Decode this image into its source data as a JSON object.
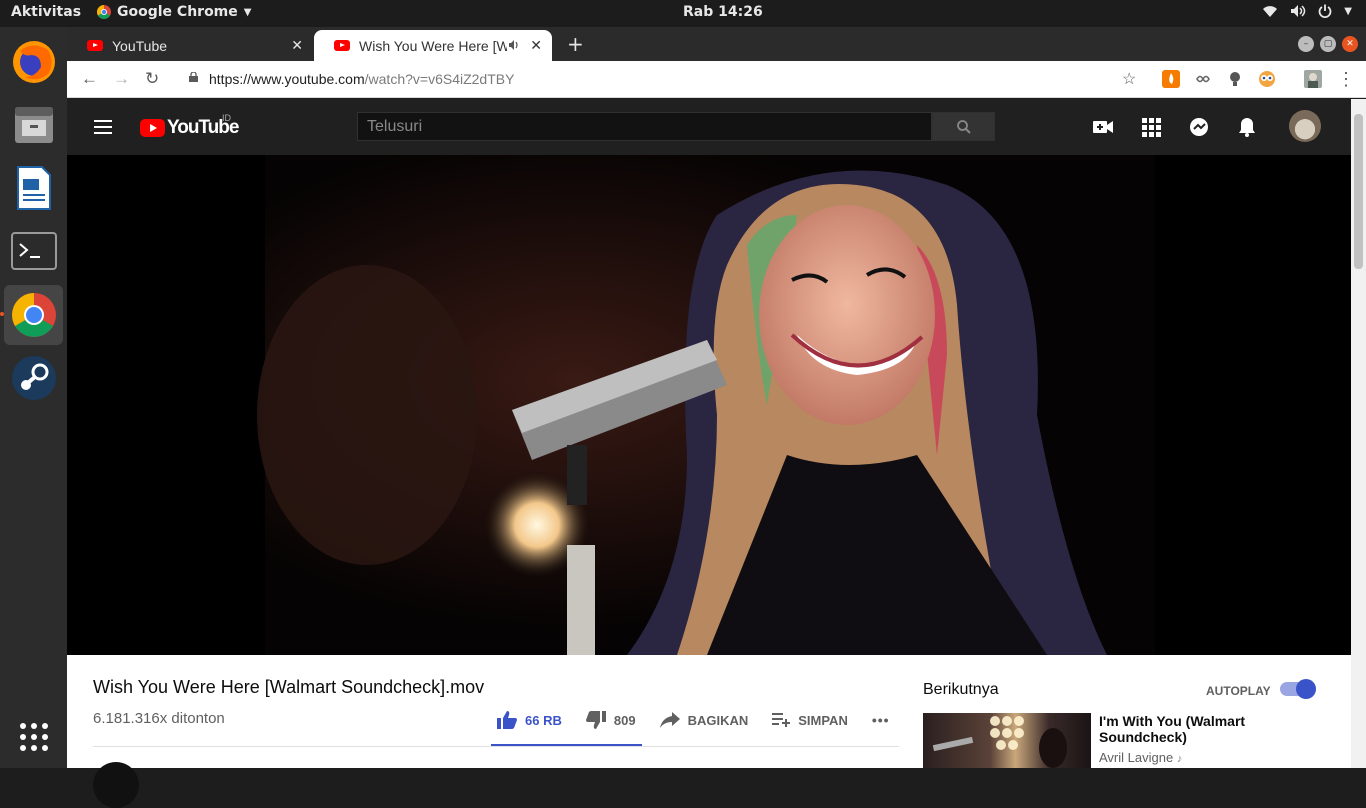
{
  "system": {
    "activities": "Aktivitas",
    "app_name": "Google Chrome",
    "clock": "Rab 14:26"
  },
  "dock": {
    "items": [
      "firefox-icon",
      "files-icon",
      "writer-icon",
      "terminal-icon",
      "chrome-icon",
      "steam-icon",
      "app-grid-icon"
    ]
  },
  "browser": {
    "tabs": [
      {
        "label": "YouTube"
      },
      {
        "label": "Wish You Were Here [W"
      }
    ],
    "url_host": "https://www.youtube.com",
    "url_path": "/watch?v=v6S4iZ2dTBY"
  },
  "youtube": {
    "logo": "YouTube",
    "region": "ID",
    "search_placeholder": "Telusuri",
    "video": {
      "title": "Wish You Were Here [Walmart Soundcheck].mov",
      "views": "6.181.316x ditonton",
      "likes": "66 RB",
      "dislikes": "809",
      "share": "BAGIKAN",
      "save": "SIMPAN",
      "more": "•••"
    },
    "sidebar": {
      "next_label": "Berikutnya",
      "autoplay_label": "AUTOPLAY",
      "autoplay_on": true,
      "recommended": [
        {
          "title": "I'm With You (Walmart Soundcheck)",
          "channel": "Avril Lavigne",
          "channel_icon": "music-note-icon"
        }
      ]
    },
    "colors": {
      "brand_red": "#ff0000",
      "accent_blue": "#3b53c8",
      "header_bg": "#202020"
    }
  }
}
